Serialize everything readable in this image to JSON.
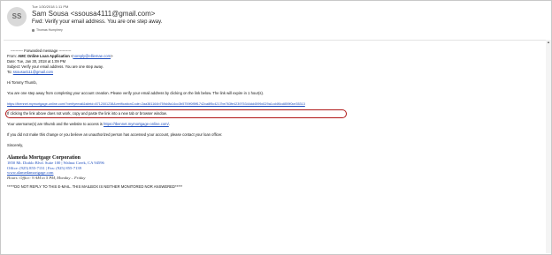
{
  "header": {
    "avatar_initials": "SS",
    "date": "Tue 1/30/2018 1:11 PM",
    "from": "Sam Sousa <ssousa4111@gmail.com>",
    "subject": "Fwd: Verify your email address. You are one step away.",
    "to": "Thomas Humphrey"
  },
  "message": {
    "fwd_header": "---------- Forwarded message ----------",
    "fwd_from_label": "From: ",
    "fwd_from_name": "AMC Online Loan Application",
    "fwd_from_addr": "noreply@elliemae.com",
    "fwd_date": "Date: Tue, Jan 30, 2018 at 1:09 PM",
    "fwd_subject": "Subject: Verify your email address. You are one step away.",
    "fwd_to_label": "To: ",
    "fwd_to_addr": "ssousa4111@gmail.com",
    "greeting": "Hi Tommy Thumb,",
    "intro": "You are one step away from completing your account creation. Please verify your email address by clicking on the link below. The link will expire in 1 hour(s).",
    "verify_url": "https://tbennet.mymortgage-online.com/?verifyemail&siteid=8712001238&verificationCode=2aa381164b759d4fa14cc3b5759f0f5ff1742ca8f5c4217be763fe423975344dd4599d029a1cd4f0cd859f0ce35313",
    "link_help": "If clicking the link above does not work, copy and paste the link into a new tab or browser window.",
    "username_text": "Your username(s) are tthumb and the website to access is ",
    "username_site": "https://tbennet.mymortgage-online.com/",
    "username_end": ".",
    "unauthorized": "If you did not make this change or you believe an unauthorized person has accessed your account, please contact your loan officer.",
    "sincerely": "Sincerely,",
    "sig_company": "Alameda Mortgage Corporation",
    "sig_address": "1850 Mt. Diablo Blvd. Suite 100 | Walnut Creek, CA 94596",
    "sig_phone": "Office: (925) 855-7131 | Fax: (925) 855-7139",
    "sig_web": "www.alamedamortgage.com",
    "sig_hours": "Hours: Office: 9 AM to 5 PM, Monday – Friday",
    "noreply": "*****DO NOT REPLY TO THIS E-MAIL. THIS MAILBOX IS NEITHER MONITORED NOR ANSWERED*****"
  }
}
